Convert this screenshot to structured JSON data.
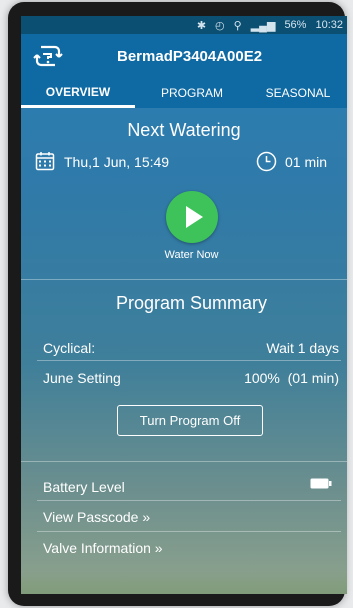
{
  "status_bar": {
    "battery": "56%",
    "time": "10:32"
  },
  "header": {
    "device_name": "BermadP3404A00E2"
  },
  "tabs": [
    {
      "label": "OVERVIEW",
      "active": true
    },
    {
      "label": "PROGRAM",
      "active": false
    },
    {
      "label": "SEASONAL",
      "active": false
    }
  ],
  "next_watering": {
    "title": "Next Watering",
    "date": "Thu,1 Jun, 15:49",
    "duration": "01 min",
    "water_now_label": "Water Now"
  },
  "program_summary": {
    "title": "Program Summary",
    "rows": [
      {
        "label": "Cyclical:",
        "value": "Wait 1 days"
      },
      {
        "label": "June Setting",
        "value": "100%  (01 min)"
      }
    ],
    "turn_off_label": "Turn Program Off"
  },
  "bottom_list": [
    {
      "label": "Battery Level"
    },
    {
      "label": "View Passcode »"
    },
    {
      "label": "Valve Information »"
    }
  ],
  "colors": {
    "accent": "#0f6aa3",
    "play": "#3ec25a"
  }
}
